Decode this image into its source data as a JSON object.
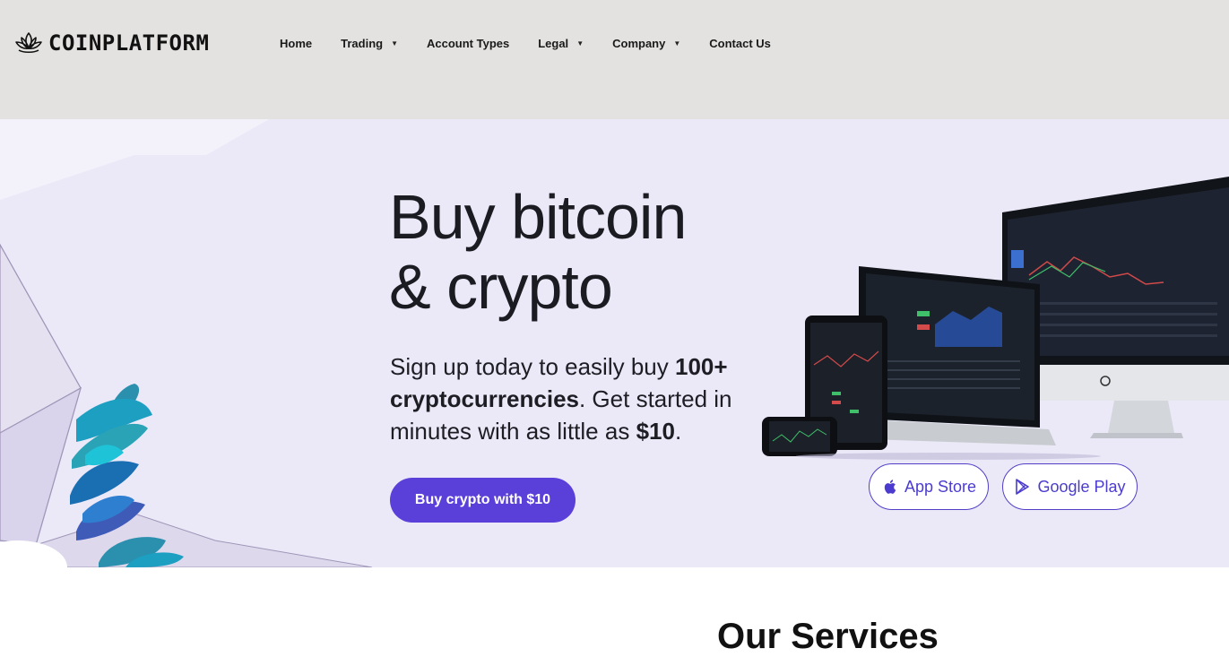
{
  "header": {
    "brand": "COINPLATFORM",
    "nav": [
      {
        "label": "Home",
        "has_dropdown": false
      },
      {
        "label": "Trading",
        "has_dropdown": true
      },
      {
        "label": "Account Types",
        "has_dropdown": false
      },
      {
        "label": "Legal",
        "has_dropdown": true
      },
      {
        "label": "Company",
        "has_dropdown": true
      },
      {
        "label": "Contact Us",
        "has_dropdown": false
      }
    ],
    "dropdown_glyph": "▼"
  },
  "hero": {
    "headline_line1": "Buy bitcoin",
    "headline_line2": "& crypto",
    "sub_part1": "Sign up today to easily buy ",
    "sub_bold1": "100+ cryptocurrencies",
    "sub_part2": ". Get started in minutes with as little as ",
    "sub_bold2": "$10",
    "sub_part3": ".",
    "cta_label": "Buy crypto with $10",
    "app_store_label": "App Store",
    "google_play_label": "Google Play"
  },
  "section": {
    "title": "Our Services"
  },
  "colors": {
    "header_bg": "#e3e2e0",
    "hero_bg": "#ebe9f8",
    "accent": "#5b3fd9",
    "text_dark": "#1b1b22"
  }
}
